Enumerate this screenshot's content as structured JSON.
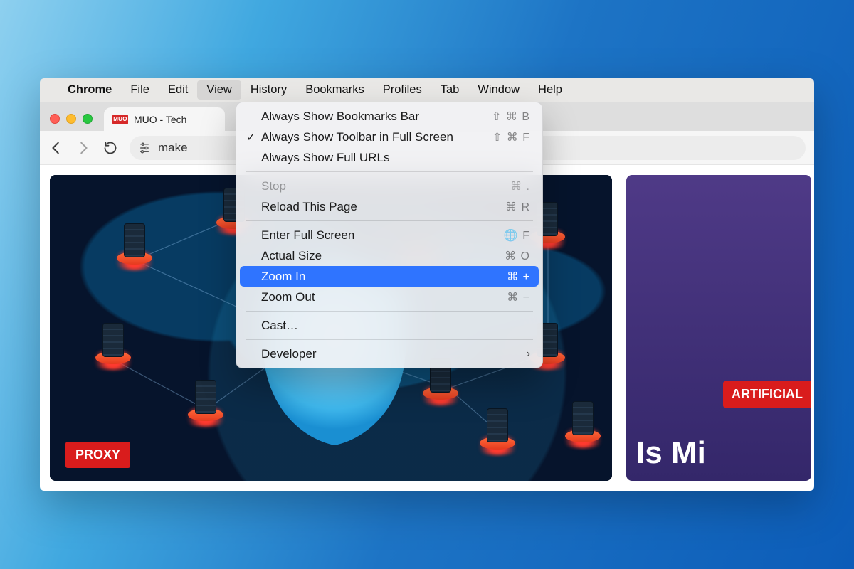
{
  "menubar": {
    "app": "Chrome",
    "items": [
      "File",
      "Edit",
      "View",
      "History",
      "Bookmarks",
      "Profiles",
      "Tab",
      "Window",
      "Help"
    ],
    "open_index": 2
  },
  "tab": {
    "favicon_text": "MUO",
    "title": "MUO - Tech"
  },
  "omnibox": {
    "text": "make"
  },
  "view_menu": {
    "groups": [
      [
        {
          "label": "Always Show Bookmarks Bar",
          "shortcut": "⇧ ⌘ B",
          "checked": false
        },
        {
          "label": "Always Show Toolbar in Full Screen",
          "shortcut": "⇧ ⌘ F",
          "checked": true
        },
        {
          "label": "Always Show Full URLs",
          "shortcut": "",
          "checked": false
        }
      ],
      [
        {
          "label": "Stop",
          "shortcut": "⌘ .",
          "disabled": true
        },
        {
          "label": "Reload This Page",
          "shortcut": "⌘ R"
        }
      ],
      [
        {
          "label": "Enter Full Screen",
          "shortcut": "🌐 F"
        },
        {
          "label": "Actual Size",
          "shortcut": "⌘ O"
        },
        {
          "label": "Zoom In",
          "shortcut": "⌘ +",
          "highlight": true
        },
        {
          "label": "Zoom Out",
          "shortcut": "⌘ −"
        }
      ],
      [
        {
          "label": "Cast…",
          "shortcut": ""
        }
      ],
      [
        {
          "label": "Developer",
          "submenu": true
        }
      ]
    ]
  },
  "page": {
    "left_badge": "PROXY",
    "right_badge": "ARTIFICIAL",
    "right_headline": "Is Mi"
  }
}
